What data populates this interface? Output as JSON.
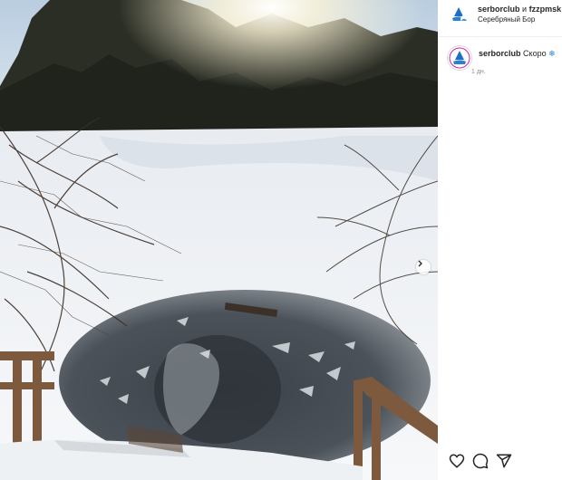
{
  "header": {
    "user1": "serborclub",
    "joiner": "и",
    "user2": "fzzpmsk",
    "location": "Серебряный Бор"
  },
  "caption": {
    "username": "serborclub",
    "text": "Скоро",
    "emoji": "❄",
    "time": "1 дн."
  },
  "icons": {
    "like": "heart-icon",
    "comment": "comment-icon",
    "share": "send-icon",
    "next": "chevron-right-icon"
  },
  "colors": {
    "accent": "#1e6fc4",
    "text": "#262626",
    "muted": "#8e8e8e"
  }
}
